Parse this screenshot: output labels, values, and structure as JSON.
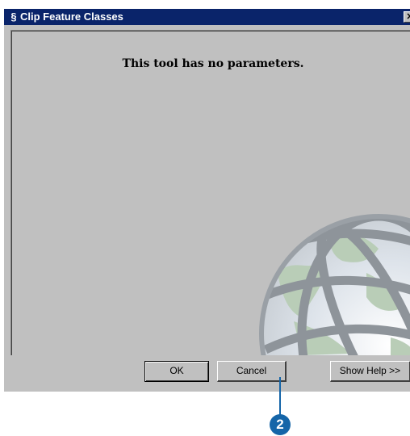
{
  "window": {
    "title": "Clip Feature Classes",
    "icon": "script-s-icon",
    "close_glyph": "✕"
  },
  "content": {
    "message": "This tool has no parameters.",
    "watermark": "globe-watermark"
  },
  "buttons": {
    "ok": "OK",
    "cancel": "Cancel",
    "show_help": "Show Help >>"
  },
  "callout": {
    "number": "2",
    "color": "#1565a8"
  },
  "colors": {
    "titlebar": "#0a246a",
    "dialog_bg": "#c0c0c0"
  }
}
